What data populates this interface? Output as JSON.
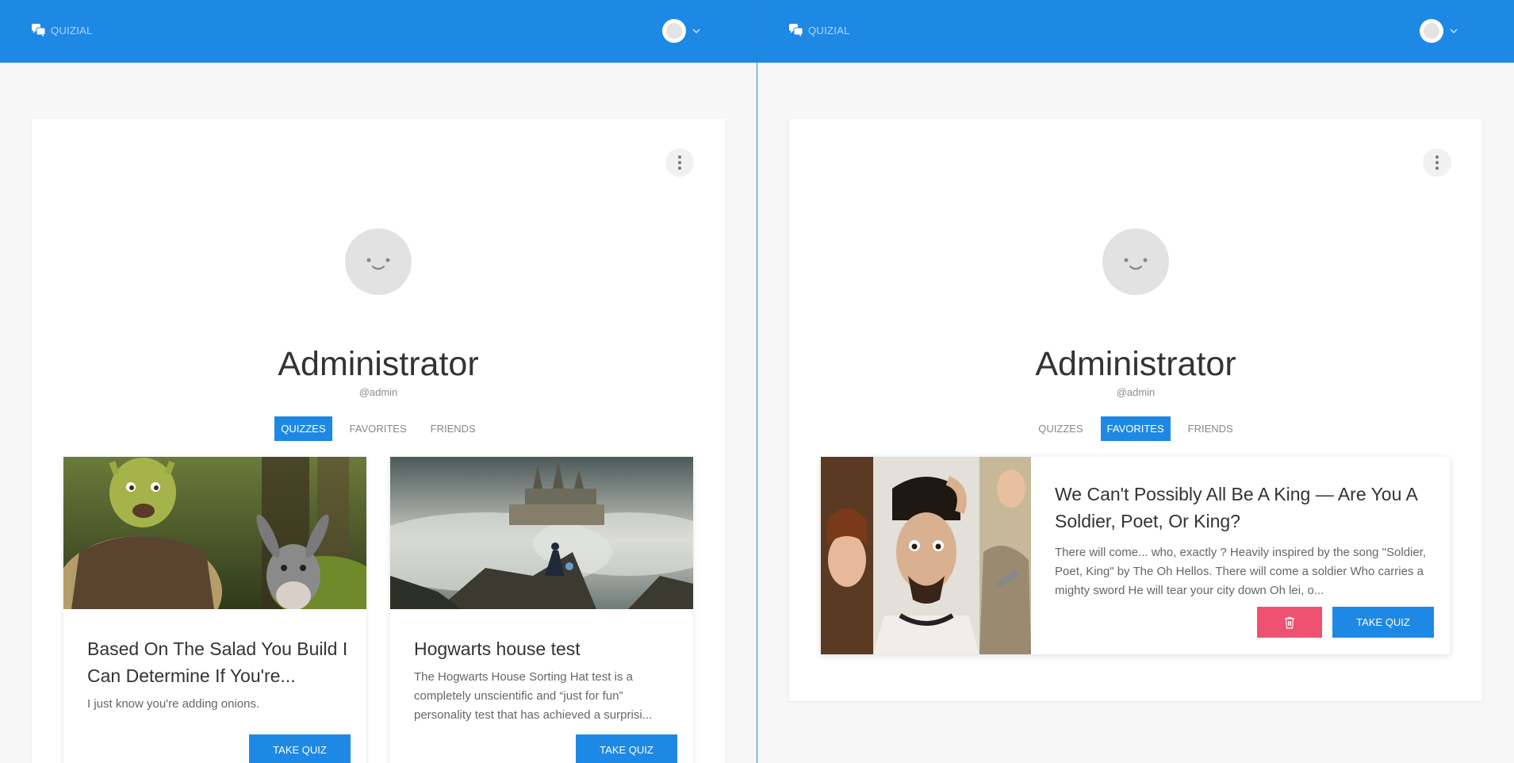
{
  "app": {
    "brand": "QUIZIAL"
  },
  "colors": {
    "primary": "#1e88e5",
    "danger": "#ef5170"
  },
  "icons": {
    "brand": "chat-bubbles-icon",
    "user_menu": "chevron-down-icon",
    "more": "more-vertical-icon",
    "delete": "trash-icon"
  },
  "left": {
    "profile": {
      "name": "Administrator",
      "handle": "@admin"
    },
    "tabs": [
      {
        "label": "QUIZZES",
        "active": true
      },
      {
        "label": "FAVORITES",
        "active": false
      },
      {
        "label": "FRIENDS",
        "active": false
      }
    ],
    "quizzes": [
      {
        "title": "Based On The Salad You Build I Can Determine If You're...",
        "description": "I just know you're adding onions.",
        "button": "TAKE QUIZ"
      },
      {
        "title": "Hogwarts house test",
        "description": "The Hogwarts House Sorting Hat test is a completely unscientific and “just for fun” personality test that has achieved a surprisi...",
        "button": "TAKE QUIZ"
      }
    ]
  },
  "right": {
    "profile": {
      "name": "Administrator",
      "handle": "@admin"
    },
    "tabs": [
      {
        "label": "QUIZZES",
        "active": false
      },
      {
        "label": "FAVORITES",
        "active": true
      },
      {
        "label": "FRIENDS",
        "active": false
      }
    ],
    "favorites": [
      {
        "title": "We Can't Possibly All Be A King — Are You A Soldier, Poet, Or King?",
        "description": "There will come... who, exactly ? Heavily inspired by the song \"Soldier, Poet, King\" by The Oh Hellos. There will come a soldier Who carries a mighty sword He will tear your city down Oh lei, o...",
        "button": "TAKE QUIZ"
      }
    ]
  }
}
